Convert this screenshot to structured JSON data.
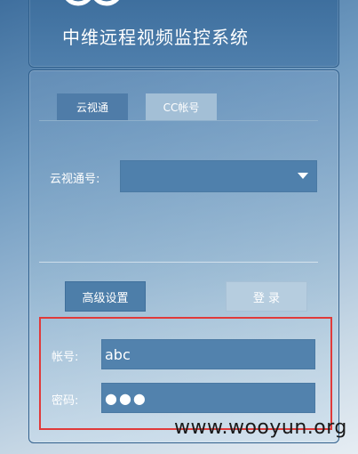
{
  "header": {
    "title": "中维远程视频监控系统"
  },
  "tabs": [
    {
      "label": "云视通",
      "active": true
    },
    {
      "label": "CC帐号",
      "active": false
    }
  ],
  "form": {
    "cloud_id_label": "云视通号:",
    "cloud_id_value": "",
    "advanced_button": "高级设置",
    "login_button": "登 录",
    "account_label": "帐号:",
    "account_value": "abc",
    "password_label": "密码:",
    "password_value": "●●●"
  },
  "watermark": {
    "text": "www.wooyun.org"
  },
  "colors": {
    "accent": "#4f7ca8",
    "highlight": "#e03a3a"
  }
}
